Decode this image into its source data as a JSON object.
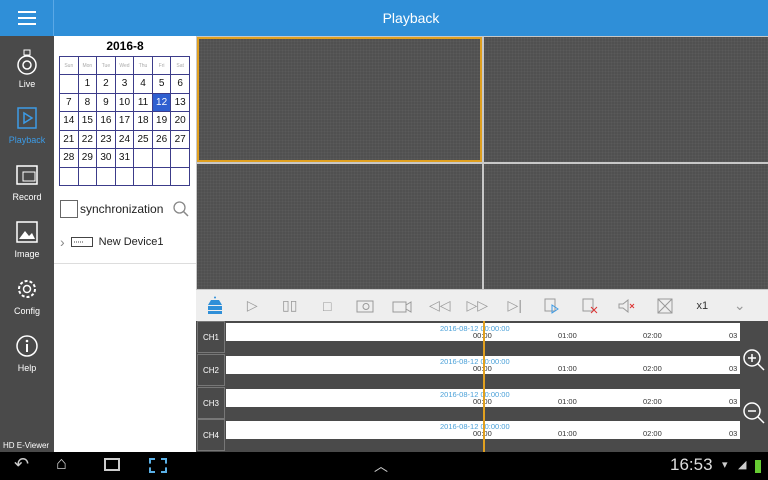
{
  "header": {
    "title": "Playback",
    "menu_icon": "hamburger-icon"
  },
  "sidebar": {
    "items": [
      {
        "label": "Live",
        "icon": "camera-icon"
      },
      {
        "label": "Playback",
        "icon": "playback-icon",
        "active": true
      },
      {
        "label": "Record",
        "icon": "record-folder-icon"
      },
      {
        "label": "Image",
        "icon": "image-icon"
      },
      {
        "label": "Config",
        "icon": "gear-icon"
      },
      {
        "label": "Help",
        "icon": "info-icon"
      }
    ],
    "brand": "HD E-Viewer"
  },
  "calendar": {
    "title": "2016-8",
    "weekdays": [
      "Sun",
      "Mon",
      "Tue",
      "Wed",
      "Thu",
      "Fri",
      "Sat"
    ],
    "weeks": [
      [
        "",
        "1",
        "2",
        "3",
        "4",
        "5",
        "6"
      ],
      [
        "7",
        "8",
        "9",
        "10",
        "11",
        "12",
        "13"
      ],
      [
        "14",
        "15",
        "16",
        "17",
        "18",
        "19",
        "20"
      ],
      [
        "21",
        "22",
        "23",
        "24",
        "25",
        "26",
        "27"
      ],
      [
        "28",
        "29",
        "30",
        "31",
        "",
        "",
        ""
      ],
      [
        "",
        "",
        "",
        "",
        "",
        "",
        ""
      ]
    ],
    "selected": "12",
    "selected_color": "#2f5fd0"
  },
  "sync": {
    "label": "synchronization",
    "checked": false
  },
  "devices": [
    {
      "name": "New Device1"
    }
  ],
  "toolbar": {
    "speed": "x1",
    "buttons": [
      "device-icon",
      "play-icon",
      "pause-icon",
      "stop-icon",
      "snapshot-icon",
      "record-icon",
      "rewind-icon",
      "fast-forward-icon",
      "step-icon",
      "playback-file-icon",
      "close-all-icon",
      "mute-icon",
      "fullscreen-icon"
    ]
  },
  "timeline": {
    "channels": [
      "CH1",
      "CH2",
      "CH3",
      "CH4"
    ],
    "cursor_label": "2016-08-12 00:00:00",
    "ticks": [
      "00:00",
      "01:00",
      "02:00",
      "03"
    ]
  },
  "statusbar": {
    "time": "16:53"
  },
  "colors": {
    "accent": "#2f8fd8",
    "cursor": "#e0a020"
  }
}
